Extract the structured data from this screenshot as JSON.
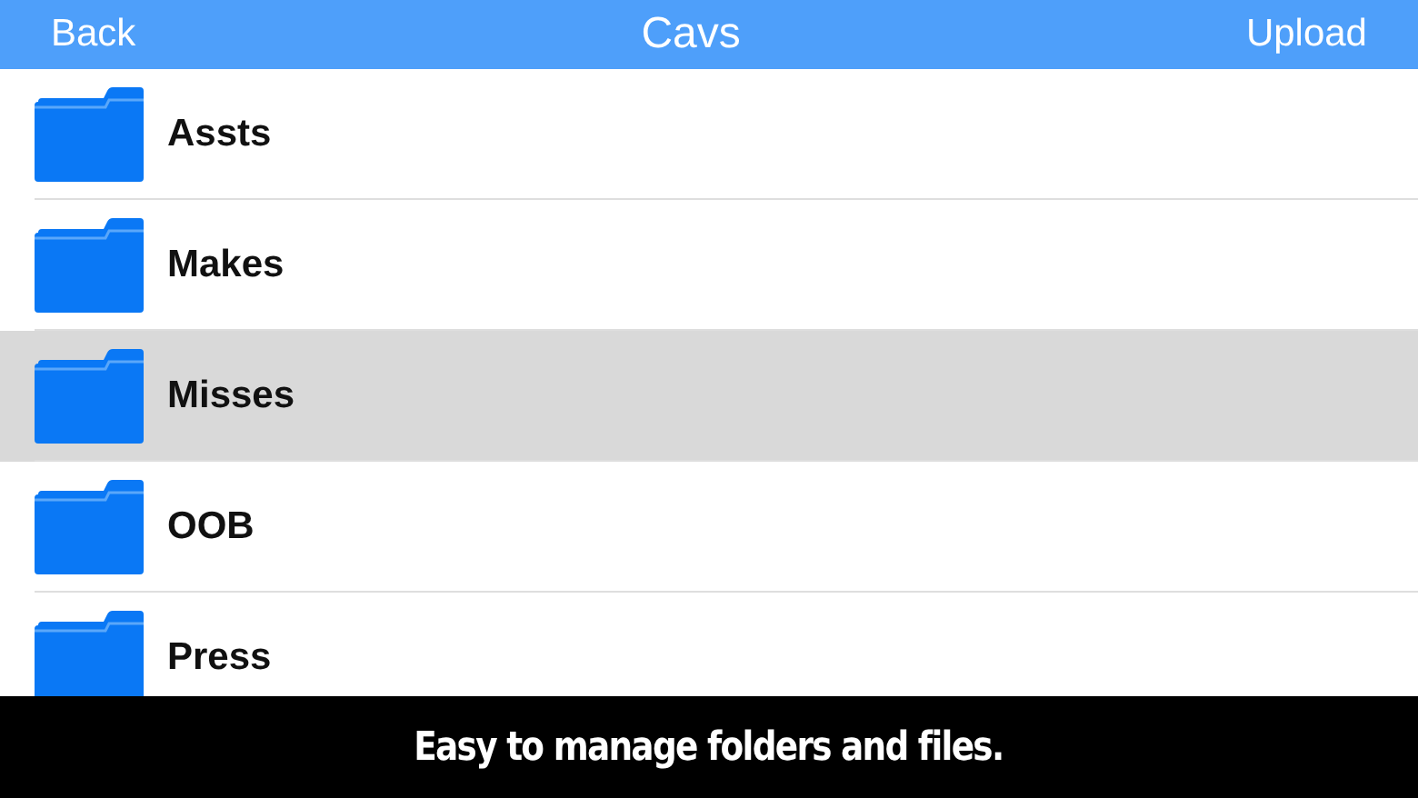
{
  "nav_bar": {
    "back": "Back",
    "title": "Cavs",
    "action": "Upload"
  },
  "folders": [
    {
      "name": "Assts",
      "selected": false
    },
    {
      "name": "Makes",
      "selected": false
    },
    {
      "name": "Misses",
      "selected": true
    },
    {
      "name": "OOB",
      "selected": false
    },
    {
      "name": "Press",
      "selected": false
    }
  ],
  "caption": "Easy to manage folders and files."
}
